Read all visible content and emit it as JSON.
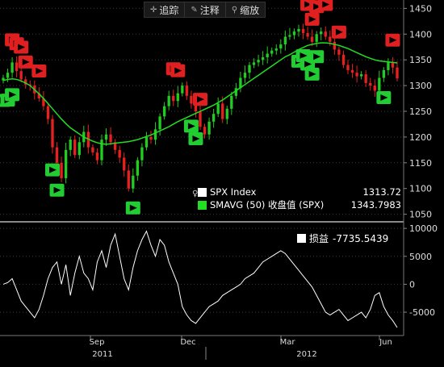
{
  "toolbar": {
    "track_label": "追踪",
    "track_icon": "crosshair-icon",
    "annotate_label": "注释",
    "annotate_icon": "pencil-icon",
    "zoom_label": "缩放",
    "zoom_icon": "magnifier-icon"
  },
  "legend": {
    "spx_name": "SPX Index",
    "spx_value": "1313.72",
    "spx_color": "#ffffff",
    "sma_name": "SMAVG (50) 收盘值 (SPX)",
    "sma_value": "1343.7983",
    "sma_color": "#22dd22"
  },
  "legend2": {
    "name": "损益",
    "value": "-7735.5439",
    "color": "#ffffff"
  },
  "colors": {
    "up": "#22cc22",
    "down": "#e82020",
    "sell_marker": "#e02020",
    "buy_marker": "#22cc33",
    "pnl_line": "#ffffff"
  },
  "chart_data": [
    {
      "type": "candlestick",
      "series": [
        {
          "name": "SPX Index",
          "close": [
            1315,
            1325,
            1345,
            1328,
            1312,
            1302,
            1300,
            1285,
            1275,
            1260,
            1235,
            1180,
            1150,
            1120,
            1175,
            1195,
            1165,
            1190,
            1210,
            1180,
            1170,
            1155,
            1195,
            1205,
            1190,
            1175,
            1160,
            1135,
            1100,
            1125,
            1155,
            1180,
            1200,
            1195,
            1215,
            1240,
            1260,
            1280,
            1270,
            1285,
            1300,
            1280,
            1265,
            1250,
            1220,
            1205,
            1230,
            1245,
            1265,
            1235,
            1255,
            1280,
            1295,
            1315,
            1325,
            1340,
            1345,
            1350,
            1355,
            1362,
            1368,
            1372,
            1380,
            1395,
            1398,
            1405,
            1410,
            1402,
            1395,
            1385,
            1400,
            1405,
            1395,
            1385,
            1370,
            1360,
            1340,
            1330,
            1325,
            1318,
            1322,
            1305,
            1300,
            1290,
            1315,
            1330,
            1345,
            1335,
            1314
          ]
        },
        {
          "name": "SMAVG (50) 收盘值 (SPX)",
          "values": [
            1310,
            1312,
            1313,
            1312,
            1309,
            1305,
            1300,
            1292,
            1284,
            1275,
            1265,
            1255,
            1245,
            1235,
            1226,
            1218,
            1212,
            1206,
            1200,
            1196,
            1192,
            1189,
            1187,
            1186,
            1187,
            1188,
            1189,
            1190,
            1191,
            1193,
            1195,
            1198,
            1201,
            1204,
            1208,
            1212,
            1216,
            1220,
            1225,
            1230,
            1234,
            1238,
            1242,
            1246,
            1250,
            1254,
            1258,
            1262,
            1267,
            1272,
            1278,
            1284,
            1290,
            1296,
            1302,
            1308,
            1314,
            1320,
            1326,
            1332,
            1338,
            1344,
            1350,
            1356,
            1360,
            1365,
            1370,
            1374,
            1378,
            1380,
            1382,
            1383,
            1383,
            1382,
            1380,
            1378,
            1375,
            1372,
            1368,
            1364,
            1360,
            1356,
            1353,
            1350,
            1348,
            1347,
            1346,
            1345,
            1344
          ]
        }
      ],
      "ylim": [
        1040,
        1460
      ],
      "yticks": [
        1050,
        1100,
        1150,
        1200,
        1250,
        1300,
        1350,
        1400,
        1450
      ],
      "sell_markers": [
        2,
        3,
        4,
        5,
        8,
        38,
        39,
        44,
        68,
        69,
        70,
        72,
        75,
        87
      ],
      "buy_markers": [
        0,
        1,
        2,
        11,
        12,
        29,
        42,
        43,
        66,
        67,
        68,
        69,
        70,
        85
      ]
    },
    {
      "type": "line",
      "series": [
        {
          "name": "损益",
          "values": [
            0,
            300,
            1000,
            -1000,
            -3000,
            -4000,
            -5000,
            -6000,
            -4500,
            -2000,
            1000,
            3000,
            4000,
            0,
            3500,
            -2000,
            2000,
            5000,
            2000,
            1000,
            -1000,
            4000,
            6000,
            3000,
            7000,
            9000,
            5000,
            1000,
            -1000,
            3000,
            6000,
            8000,
            9500,
            7000,
            5000,
            8000,
            7000,
            4000,
            2000,
            0,
            -4000,
            -5500,
            -6500,
            -7000,
            -6000,
            -5000,
            -4000,
            -3500,
            -3000,
            -2000,
            -1500,
            -1000,
            -500,
            0,
            1000,
            1500,
            2000,
            3000,
            4000,
            4500,
            5000,
            5500,
            6000,
            5500,
            4500,
            3500,
            2500,
            1500,
            500,
            -500,
            -2000,
            -3500,
            -5000,
            -5500,
            -5000,
            -4500,
            -5500,
            -6500,
            -6000,
            -5500,
            -5000,
            -6000,
            -4500,
            -2000,
            -1500,
            -4000,
            -5500,
            -6500,
            -7735.5439
          ]
        }
      ],
      "ylim": [
        -8600,
        10600
      ],
      "yticks": [
        -5000,
        0,
        5000,
        10000
      ]
    }
  ],
  "xaxis": {
    "month_labels": [
      {
        "label": "Sep",
        "index": 29
      },
      {
        "label": "Dec",
        "index": 49
      },
      {
        "label": "Mar",
        "index": 75
      },
      {
        "label": "Jun",
        "index": 97
      }
    ],
    "year_labels": [
      {
        "label": "2011",
        "index": 28
      },
      {
        "label": "2012",
        "index": 80
      }
    ]
  }
}
